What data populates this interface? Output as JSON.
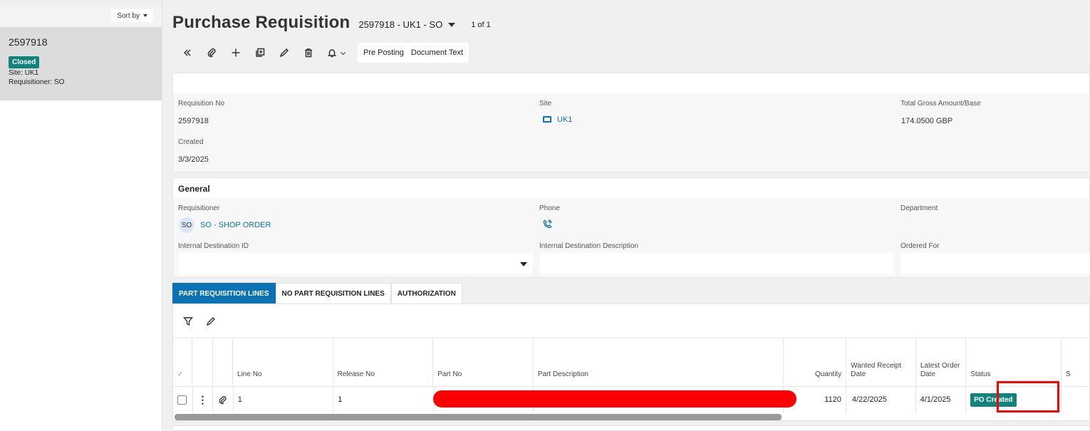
{
  "navigator": {
    "sort_label": "Sort by",
    "record_number": "2597918",
    "status": "Closed",
    "site_line": "Site:   UK1",
    "requisitioner_line": "Requisitioner:   SO"
  },
  "header": {
    "title": "Purchase Requisition",
    "record_selector": "2597918 - UK1 - SO",
    "pager": "1 of 1"
  },
  "toolbar": {
    "icons": [
      "double-chevron-left-icon",
      "paperclip-icon",
      "plus-icon",
      "copy-icon",
      "pencil-icon",
      "trash-icon",
      "bell-icon"
    ],
    "pre_posting": "Pre Posting",
    "document_text": "Document Text"
  },
  "summary": {
    "requisition_no_label": "Requisition No",
    "requisition_no": "2597918",
    "site_label": "Site",
    "site": "UK1",
    "total_label": "Total Gross Amount/Base",
    "total": "174.0500 GBP",
    "created_label": "Created",
    "created": "3/3/2025"
  },
  "general": {
    "title": "General",
    "requisitioner_label": "Requisitioner",
    "requisitioner_initials": "SO",
    "requisitioner": "SO - SHOP ORDER",
    "phone_label": "Phone",
    "department_label": "Department",
    "internal_dest_id_label": "Internal Destination ID",
    "internal_dest_desc_label": "Internal Destination Description",
    "ordered_for_label": "Ordered For"
  },
  "tabs": [
    {
      "label": "PART REQUISITION LINES",
      "active": true
    },
    {
      "label": "NO PART REQUISITION LINES",
      "active": false
    },
    {
      "label": "AUTHORIZATION",
      "active": false
    }
  ],
  "grid": {
    "columns": {
      "line_no": "Line No",
      "release_no": "Release No",
      "part_no": "Part No",
      "part_description": "Part Description",
      "quantity": "Quantity",
      "wanted_receipt_date": "Wanted Receipt Date",
      "latest_order_date": "Latest Order Date",
      "status": "Status",
      "next": "S"
    },
    "rows": [
      {
        "line_no": "1",
        "release_no": "1",
        "quantity": "1120",
        "wanted_receipt_date": "4/22/2025",
        "latest_order_date": "4/1/2025",
        "status": "PO Created"
      }
    ]
  },
  "colors": {
    "accent": "#0b72b5",
    "status_teal": "#11837c",
    "annotation_red": "#ff0000"
  }
}
